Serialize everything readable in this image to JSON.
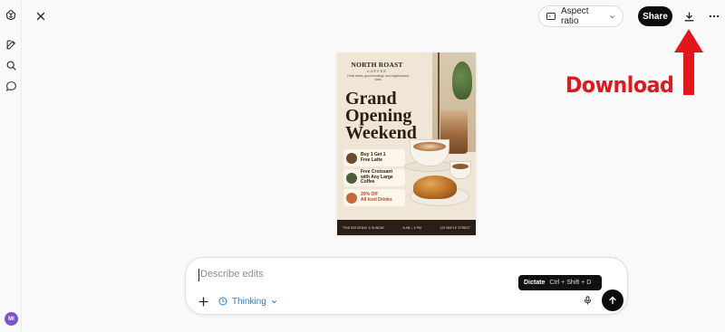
{
  "sidebar": {
    "icons": [
      "chatgpt-logo-icon",
      "new-chat-icon",
      "search-icon",
      "chat-bubble-icon"
    ],
    "avatar_initials": "MI"
  },
  "topbar": {
    "aspect_ratio_label": "Aspect ratio",
    "share_label": "Share"
  },
  "annotation": {
    "download_text": "Download",
    "color": "#e5161b"
  },
  "poster": {
    "brand": "NORTH ROAST",
    "brand_sub": "COFFEE",
    "tagline": "Fresh brews, good mornings, and neighborhood vibes",
    "title_lines": [
      "Grand",
      "Opening",
      "Weekend"
    ],
    "offers": [
      {
        "line1": "Buy 1 Get 1",
        "line2": "Free Latte",
        "badge_color": "#6b4a2f"
      },
      {
        "line1": "Free Croissant",
        "line2": "with Any Large Coffee",
        "badge_color": "#4d5f3a"
      },
      {
        "line1": "20% Off",
        "line2": "All Iced Drinks",
        "badge_color": "#c8663a"
      }
    ],
    "footer_left": "THIS SATURDAY & SUNDAY",
    "footer_mid": "8 AM – 6 PM",
    "footer_right": "123 MAPLE STREET"
  },
  "composer": {
    "placeholder": "Describe edits",
    "mode_label": "Thinking",
    "mode_color": "#2a7bd8"
  },
  "tooltip": {
    "label": "Dictate",
    "shortcut": "Ctrl + Shift + D"
  }
}
